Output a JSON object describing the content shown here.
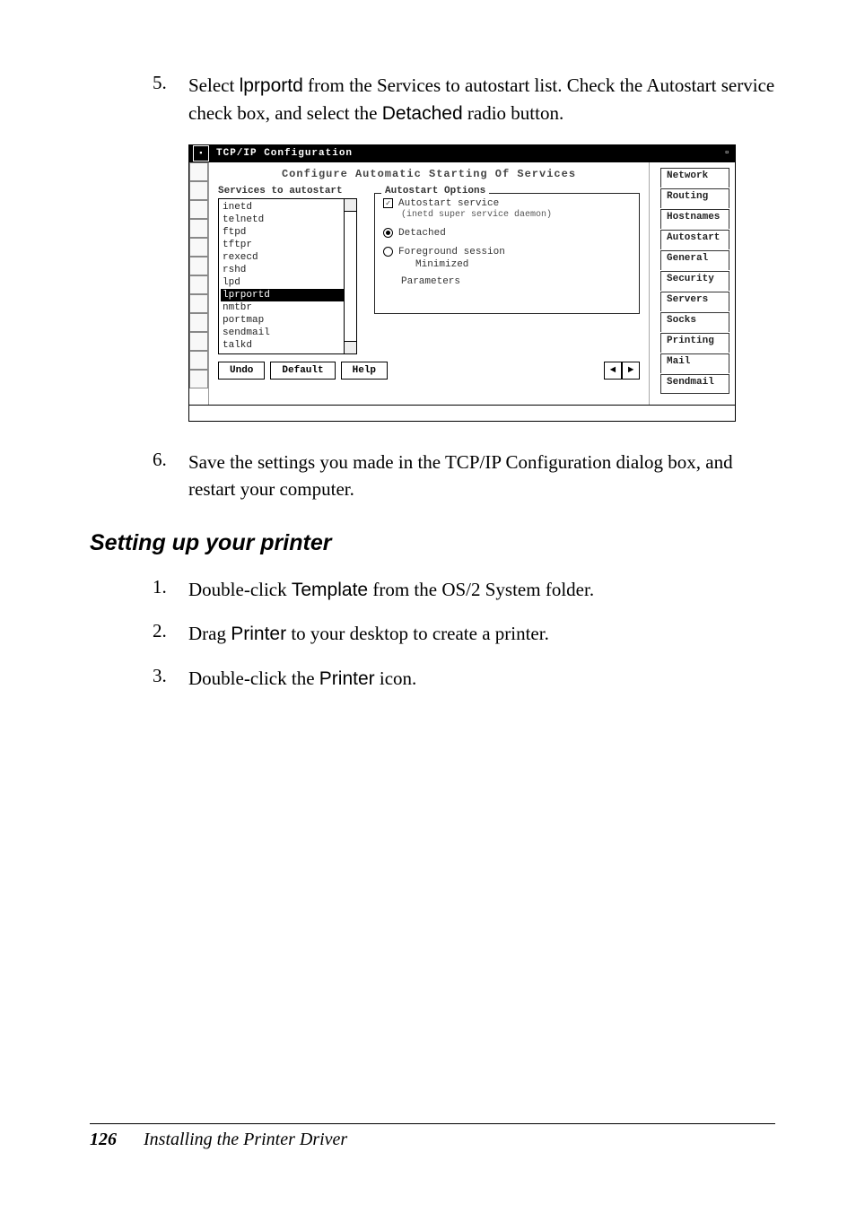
{
  "step5": {
    "num": "5.",
    "text_pre": "Select ",
    "kw1": "lprportd",
    "text_mid": " from the Services to autostart list. Check the Autostart service check box, and select the ",
    "kw2": "Detached",
    "text_post": " radio button."
  },
  "screenshot": {
    "title": "TCP/IP Configuration",
    "header": "Configure Automatic Starting Of Services",
    "list_label": "Services to autostart",
    "items": [
      "inetd",
      "telnetd",
      "ftpd",
      "tftpr",
      "rexecd",
      "rshd",
      "lpd",
      "lprportd",
      "nmtbr",
      "portmap",
      "sendmail",
      "talkd"
    ],
    "selected_index": 7,
    "group_label": "Autostart Options",
    "autostart_chk": "Autostart service",
    "autostart_hint": "(inetd super service daemon)",
    "detached_radio": "Detached",
    "foreground_radio": "Foreground session",
    "minimized": "Minimized",
    "parameters": "Parameters",
    "right_tabs": [
      "Network",
      "Routing",
      "Hostnames",
      "Autostart",
      "General",
      "Security",
      "Servers",
      "Socks",
      "Printing",
      "Mail",
      "Sendmail"
    ],
    "buttons": {
      "undo": "Undo",
      "default": "Default",
      "help": "Help"
    }
  },
  "step6": {
    "num": "6.",
    "text": "Save the settings you made in the TCP/IP Configuration dialog box, and restart your computer."
  },
  "section": "Setting up your printer",
  "step_p1": {
    "num": "1.",
    "pre": "Double-click ",
    "kw": "Template",
    "post": " from the OS/2 System folder."
  },
  "step_p2": {
    "num": "2.",
    "pre": "Drag ",
    "kw": "Printer",
    "post": " to your desktop to create a printer."
  },
  "step_p3": {
    "num": "3.",
    "pre": "Double-click the ",
    "kw": "Printer",
    "post": " icon."
  },
  "footer": {
    "page": "126",
    "title": "Installing the Printer Driver"
  }
}
